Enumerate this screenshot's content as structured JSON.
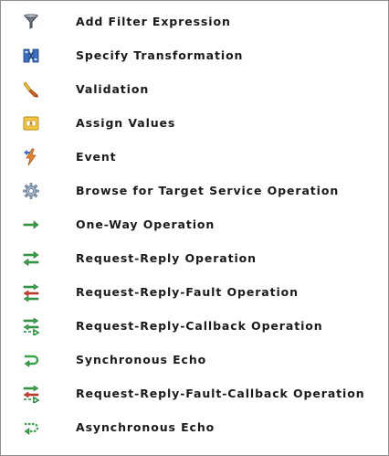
{
  "legend": {
    "items": [
      {
        "icon": "filter-funnel-icon",
        "label": "Add Filter Expression"
      },
      {
        "icon": "transformation-icon",
        "label": "Specify Transformation"
      },
      {
        "icon": "validation-brush-icon",
        "label": "Validation"
      },
      {
        "icon": "assign-values-icon",
        "label": "Assign Values"
      },
      {
        "icon": "event-lightning-icon",
        "label": "Event"
      },
      {
        "icon": "browse-gear-icon",
        "label": "Browse for Target Service Operation"
      },
      {
        "icon": "one-way-arrow-icon",
        "label": "One-Way Operation"
      },
      {
        "icon": "request-reply-arrows-icon",
        "label": "Request-Reply Operation"
      },
      {
        "icon": "request-reply-fault-arrows-icon",
        "label": "Request-Reply-Fault Operation"
      },
      {
        "icon": "request-reply-callback-arrows-icon",
        "label": "Request-Reply-Callback Operation"
      },
      {
        "icon": "synchronous-echo-icon",
        "label": "Synchronous Echo"
      },
      {
        "icon": "request-reply-fault-callback-arrows-icon",
        "label": "Request-Reply-Fault-Callback Operation"
      },
      {
        "icon": "asynchronous-echo-icon",
        "label": "Asynchronous Echo"
      }
    ]
  },
  "colors": {
    "text": "#1a1a1a",
    "border": "#8f8f8f",
    "green_arrow": "#3aa24a",
    "red_arrow": "#d2402f",
    "gold": "#e7a32a",
    "blue": "#3a6fc4"
  }
}
